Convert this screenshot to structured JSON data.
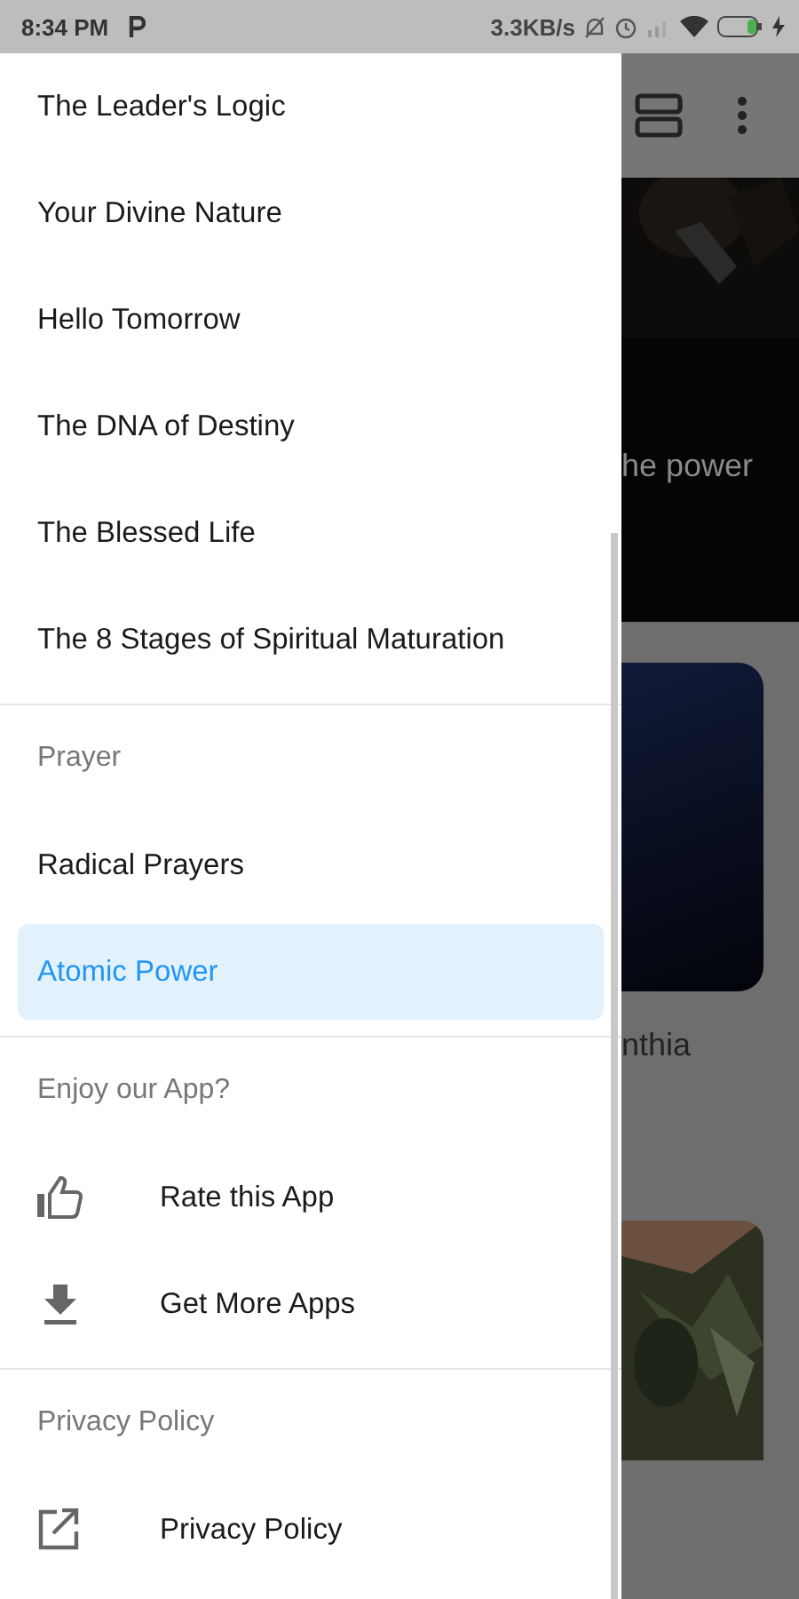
{
  "status_bar": {
    "time": "8:34 PM",
    "network_speed": "3.3KB/s"
  },
  "drawer": {
    "sections": [
      {
        "items": [
          {
            "label": "The Leader's Logic",
            "kind": "text",
            "selected": false
          },
          {
            "label": "Your Divine Nature",
            "kind": "text",
            "selected": false
          },
          {
            "label": "Hello Tomorrow",
            "kind": "text",
            "selected": false
          },
          {
            "label": "The DNA of Destiny",
            "kind": "text",
            "selected": false
          },
          {
            "label": "The Blessed Life",
            "kind": "text",
            "selected": false
          },
          {
            "label": "The 8 Stages of Spiritual Maturation",
            "kind": "text",
            "selected": false
          }
        ]
      },
      {
        "header": "Prayer",
        "items": [
          {
            "label": "Radical Prayers",
            "kind": "text",
            "selected": false
          },
          {
            "label": "Atomic Power",
            "kind": "text",
            "selected": true
          }
        ]
      },
      {
        "header": "Enjoy our App?",
        "items": [
          {
            "label": "Rate this App",
            "kind": "rate",
            "selected": false
          },
          {
            "label": "Get More Apps",
            "kind": "download",
            "selected": false
          }
        ]
      },
      {
        "header": "Privacy Policy",
        "items": [
          {
            "label": "Privacy Policy",
            "kind": "external",
            "selected": false
          }
        ]
      }
    ]
  },
  "background": {
    "banner_caption": "he power",
    "card_caption": "nthia"
  }
}
